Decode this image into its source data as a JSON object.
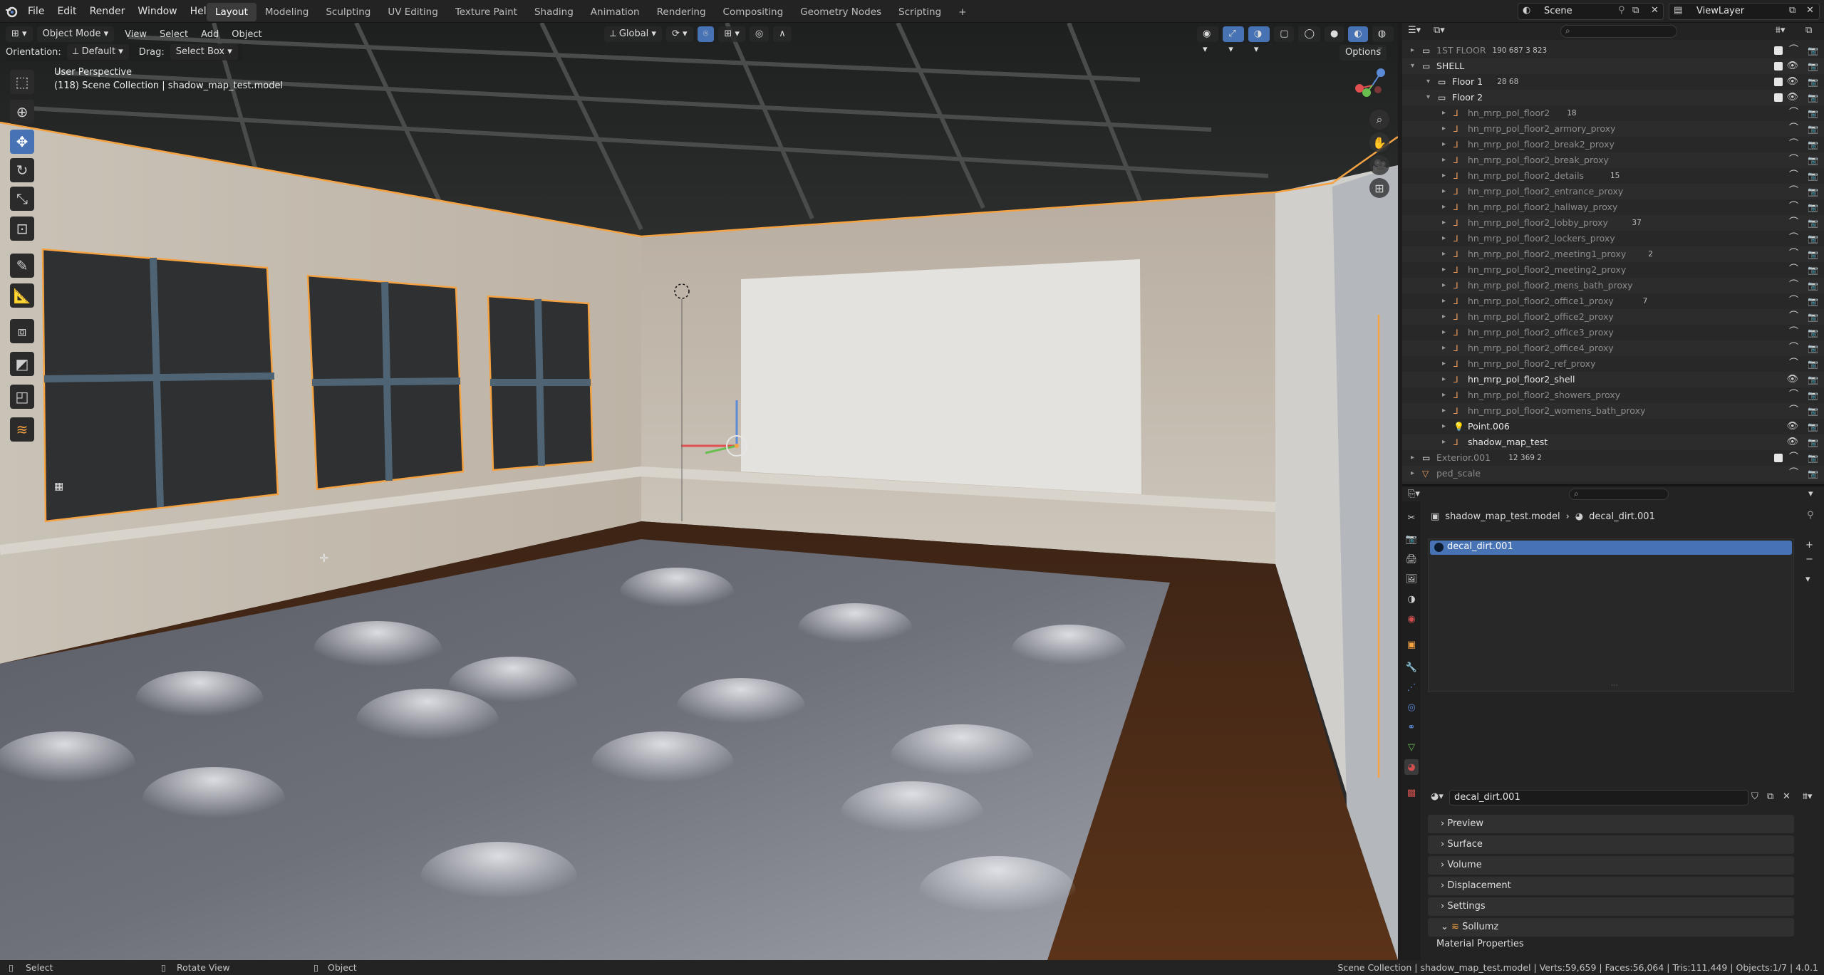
{
  "menu": [
    "File",
    "Edit",
    "Render",
    "Window",
    "Help"
  ],
  "workspaces": [
    "Layout",
    "Modeling",
    "Sculpting",
    "UV Editing",
    "Texture Paint",
    "Shading",
    "Animation",
    "Rendering",
    "Compositing",
    "Geometry Nodes",
    "Scripting"
  ],
  "active_workspace": "Layout",
  "add_workspace": "+",
  "scene_label": "Scene",
  "viewlayer_label": "ViewLayer",
  "viewport": {
    "mode": "Object Mode",
    "view": "View",
    "select": "Select",
    "add": "Add",
    "object": "Object",
    "transform": "Global",
    "orientation_label": "Orientation:",
    "orientation_value": "Default",
    "drag_label": "Drag:",
    "drag_value": "Select Box",
    "options": "Options",
    "perspective": "User Perspective",
    "collection_info": "(118) Scene Collection | shadow_map_test.model",
    "axis_x": "X",
    "axis_y": "Y",
    "axis_z": "Z"
  },
  "outliner": {
    "search_placeholder": "",
    "rows": [
      {
        "name": "1ST FLOOR",
        "counts": "190 687  3 823",
        "indent": 0,
        "type": "collection",
        "dim": true
      },
      {
        "name": "SHELL",
        "counts": "",
        "indent": 0,
        "type": "collection",
        "dim": false
      },
      {
        "name": "Floor 1",
        "counts": "28  68",
        "indent": 1,
        "type": "collection",
        "dim": false
      },
      {
        "name": "Floor 2",
        "counts": "",
        "indent": 1,
        "type": "collection",
        "dim": false
      },
      {
        "name": "hn_mrp_pol_floor2",
        "counts": "18",
        "indent": 2,
        "type": "empty",
        "dim": true
      },
      {
        "name": "hn_mrp_pol_floor2_armory_proxy",
        "counts": "",
        "indent": 2,
        "type": "empty",
        "dim": true
      },
      {
        "name": "hn_mrp_pol_floor2_break2_proxy",
        "counts": "",
        "indent": 2,
        "type": "empty",
        "dim": true
      },
      {
        "name": "hn_mrp_pol_floor2_break_proxy",
        "counts": "",
        "indent": 2,
        "type": "empty",
        "dim": true
      },
      {
        "name": "hn_mrp_pol_floor2_details",
        "counts": "15",
        "indent": 2,
        "type": "empty",
        "dim": true
      },
      {
        "name": "hn_mrp_pol_floor2_entrance_proxy",
        "counts": "",
        "indent": 2,
        "type": "empty",
        "dim": true
      },
      {
        "name": "hn_mrp_pol_floor2_hallway_proxy",
        "counts": "",
        "indent": 2,
        "type": "empty",
        "dim": true
      },
      {
        "name": "hn_mrp_pol_floor2_lobby_proxy",
        "counts": "37",
        "indent": 2,
        "type": "empty",
        "dim": true
      },
      {
        "name": "hn_mrp_pol_floor2_lockers_proxy",
        "counts": "",
        "indent": 2,
        "type": "empty",
        "dim": true
      },
      {
        "name": "hn_mrp_pol_floor2_meeting1_proxy",
        "counts": "2",
        "indent": 2,
        "type": "empty",
        "dim": true
      },
      {
        "name": "hn_mrp_pol_floor2_meeting2_proxy",
        "counts": "",
        "indent": 2,
        "type": "empty",
        "dim": true
      },
      {
        "name": "hn_mrp_pol_floor2_mens_bath_proxy",
        "counts": "",
        "indent": 2,
        "type": "empty",
        "dim": true
      },
      {
        "name": "hn_mrp_pol_floor2_office1_proxy",
        "counts": "7",
        "indent": 2,
        "type": "empty",
        "dim": true
      },
      {
        "name": "hn_mrp_pol_floor2_office2_proxy",
        "counts": "",
        "indent": 2,
        "type": "empty",
        "dim": true
      },
      {
        "name": "hn_mrp_pol_floor2_office3_proxy",
        "counts": "",
        "indent": 2,
        "type": "empty",
        "dim": true
      },
      {
        "name": "hn_mrp_pol_floor2_office4_proxy",
        "counts": "",
        "indent": 2,
        "type": "empty",
        "dim": true
      },
      {
        "name": "hn_mrp_pol_floor2_ref_proxy",
        "counts": "",
        "indent": 2,
        "type": "empty",
        "dim": true
      },
      {
        "name": "hn_mrp_pol_floor2_shell",
        "counts": "",
        "indent": 2,
        "type": "empty",
        "dim": false
      },
      {
        "name": "hn_mrp_pol_floor2_showers_proxy",
        "counts": "",
        "indent": 2,
        "type": "empty",
        "dim": true
      },
      {
        "name": "hn_mrp_pol_floor2_womens_bath_proxy",
        "counts": "",
        "indent": 2,
        "type": "empty",
        "dim": true
      },
      {
        "name": "Point.006",
        "counts": "",
        "indent": 2,
        "type": "light",
        "dim": false
      },
      {
        "name": "shadow_map_test",
        "counts": "",
        "indent": 2,
        "type": "empty",
        "dim": false
      },
      {
        "name": "Exterior.001",
        "counts": "12 369  2",
        "indent": 0,
        "type": "collection",
        "dim": true
      },
      {
        "name": "ped_scale",
        "counts": "",
        "indent": 0,
        "type": "mesh",
        "dim": true
      }
    ]
  },
  "properties": {
    "breadcrumb_object": "shadow_map_test.model",
    "breadcrumb_material": "decal_dirt.001",
    "slot_name": "decal_dirt.001",
    "material_name": "decal_dirt.001",
    "panels": [
      "Preview",
      "Surface",
      "Volume",
      "Displacement",
      "Settings",
      "Sollumz"
    ],
    "sub_panel": "Material Properties"
  },
  "status": {
    "select": "Select",
    "rotate": "Rotate View",
    "object": "Object",
    "info": "Scene Collection | shadow_map_test.model | Verts:59,659 | Faces:56,064 | Tris:111,449 | Objects:1/7 | 4.0.1"
  },
  "colors": {
    "accent": "#4772b3",
    "selection": "#f5a243",
    "header": "#232323"
  }
}
